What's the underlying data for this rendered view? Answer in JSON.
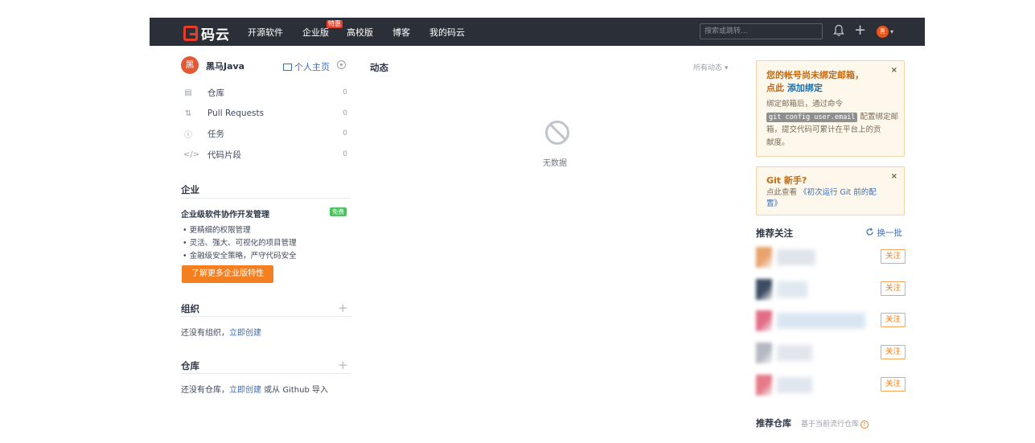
{
  "navbar": {
    "logo_text": "码云",
    "links": [
      "开源软件",
      "企业版",
      "高校版",
      "博客",
      "我的码云"
    ],
    "badge": "特惠",
    "search_placeholder": "搜索或跳转...",
    "avatar_text": "黑",
    "caret": "▾",
    "plus": "+"
  },
  "sidebar": {
    "user": {
      "avatar_text": "黑",
      "name": "黑马Java",
      "homepage": "个人主页"
    },
    "items": [
      {
        "icon": "▤",
        "label": "仓库",
        "count": "0"
      },
      {
        "icon": "⇅",
        "label": "Pull Requests",
        "count": "0"
      },
      {
        "icon": "ⓘ",
        "label": "任务",
        "count": "0"
      },
      {
        "icon": "</>",
        "label": "代码片段",
        "count": "0"
      }
    ],
    "enterprise": {
      "title": "企业",
      "subtitle": "企业级软件协作开发管理",
      "badge": "免费",
      "bullets": [
        "• 更精细的权限管理",
        "• 灵活、强大、可视化的项目管理",
        "• 金融级安全策略，严守代码安全"
      ],
      "button": "了解更多企业版特性"
    },
    "orgs": {
      "title": "组织",
      "text": "还没有组织，",
      "link": "立即创建",
      "plus": "+"
    },
    "repos": {
      "title": "仓库",
      "text": "还没有仓库，",
      "link": "立即创建",
      "text2": " 或从 Github 导入",
      "plus": "+"
    }
  },
  "feed": {
    "title": "动态",
    "filter": "所有动态 ▾",
    "empty": "无数据"
  },
  "right": {
    "email_notice": {
      "title_line1": "您的帐号尚未绑定邮箱，",
      "title_line2_prefix": "点此 ",
      "title_line2_link": "添加绑定",
      "text_line1": "绑定邮箱后，通过命令",
      "code": "git config user.email",
      "text_line2_suffix": " 配置绑定邮",
      "text_line3": "箱，提交代码可累计在平台上的贡",
      "text_line4": "献度。",
      "close": "×"
    },
    "git_notice": {
      "title": "Git 新手?",
      "text_prefix": "点此查看 ",
      "link_line1": "《初次运行 Git 前的配",
      "link_line2": "置》",
      "close": "×"
    },
    "recommend": {
      "title": "推荐关注",
      "refresh": "换一批",
      "follow_label": "关注",
      "rows": [
        {
          "color": "#e9a36c",
          "color2": "#dfe4ea"
        },
        {
          "color": "#3d4c63",
          "color2": "#dfe8f0"
        },
        {
          "color": "#e36d86",
          "color2": "#d9e6f1"
        },
        {
          "color": "#b5b9c2",
          "color2": "#e2e6ec"
        },
        {
          "color": "#e57a88",
          "color2": "#e0e6ef"
        }
      ]
    },
    "recommend_repo": {
      "title": "推荐仓库",
      "subtitle": "基于当前流行仓库",
      "help": "?"
    }
  },
  "colors": {
    "navbar": "#2b2f38",
    "accent": "#f37f20",
    "brand_red": "#e93d2a",
    "link": "#3a6db6"
  }
}
